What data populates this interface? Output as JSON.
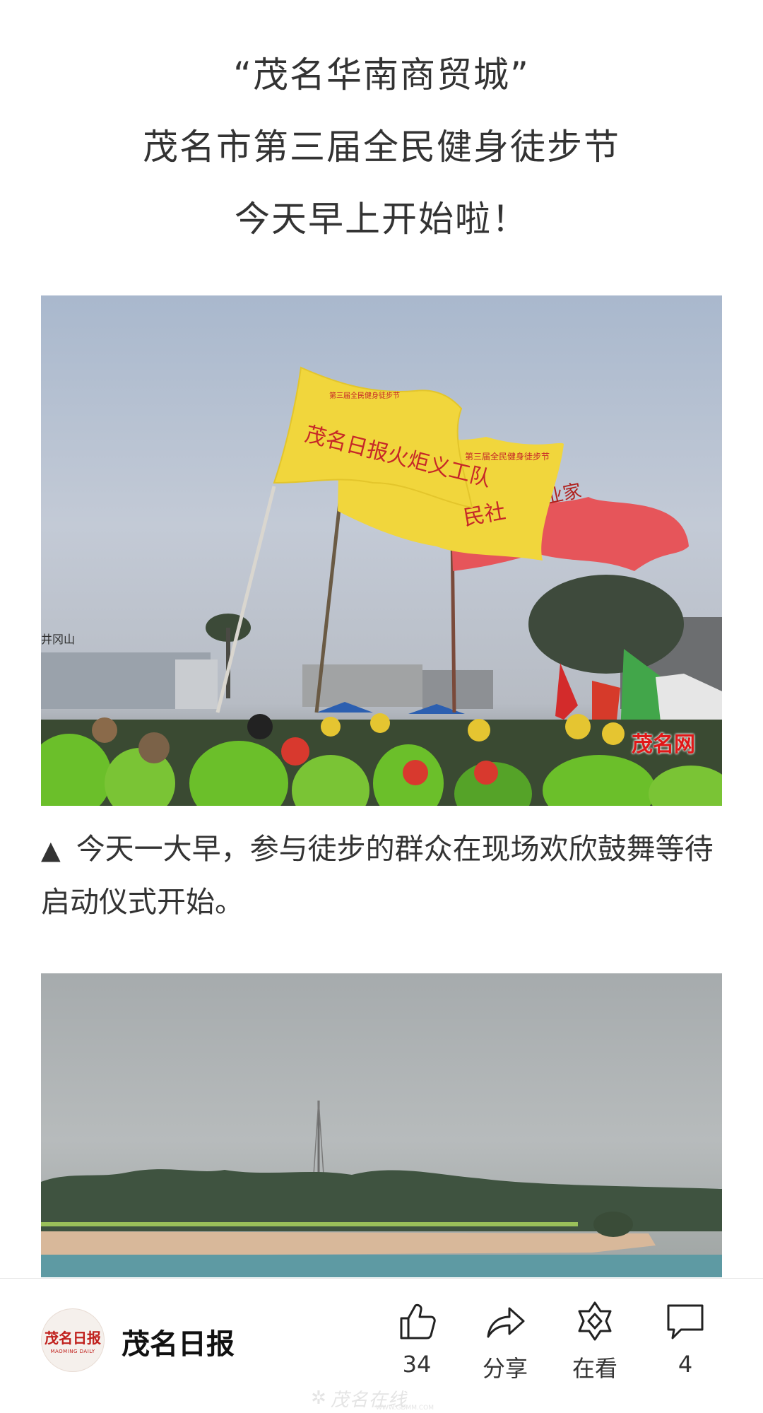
{
  "article": {
    "headline_lines": [
      "“茂名华南商贸城”",
      "茂名市第三届全民健身徒步节",
      "今天早上开始啦！"
    ],
    "photo1": {
      "flag_yellow_1_text": "茂名日报火炬义工队",
      "flag_yellow_1_small": "第三届全民健身徒步节",
      "flag_yellow_2_text": "民社",
      "flag_yellow_2_small": "第三届全民健身徒步节",
      "flag_red_text": "企业家",
      "sign_left": "井冈山",
      "watermark": "茂名网"
    },
    "caption_marker": "▲",
    "caption": "今天一大早，参与徒步的群众在现场欢欣鼓舞等待启动仪式开始。"
  },
  "bottom_bar": {
    "logo_text": "茂名日报",
    "logo_subtext": "MAOMING DAILY",
    "account_name": "茂名日报",
    "actions": {
      "like": {
        "icon": "thumbs-up-icon",
        "label": "34"
      },
      "share": {
        "icon": "share-arrow-icon",
        "label": "分享"
      },
      "looking": {
        "icon": "looking-star-icon",
        "label": "在看"
      },
      "comment": {
        "icon": "comment-bubble-icon",
        "label": "4"
      }
    },
    "site_mark": "茂名在线",
    "site_url": "WWW.GDMM.COM"
  },
  "colors": {
    "flag_yellow": "#f1d63c",
    "flag_red": "#e6555a",
    "vest_green": "#6bbf2a",
    "watermark_red": "#e01818"
  }
}
